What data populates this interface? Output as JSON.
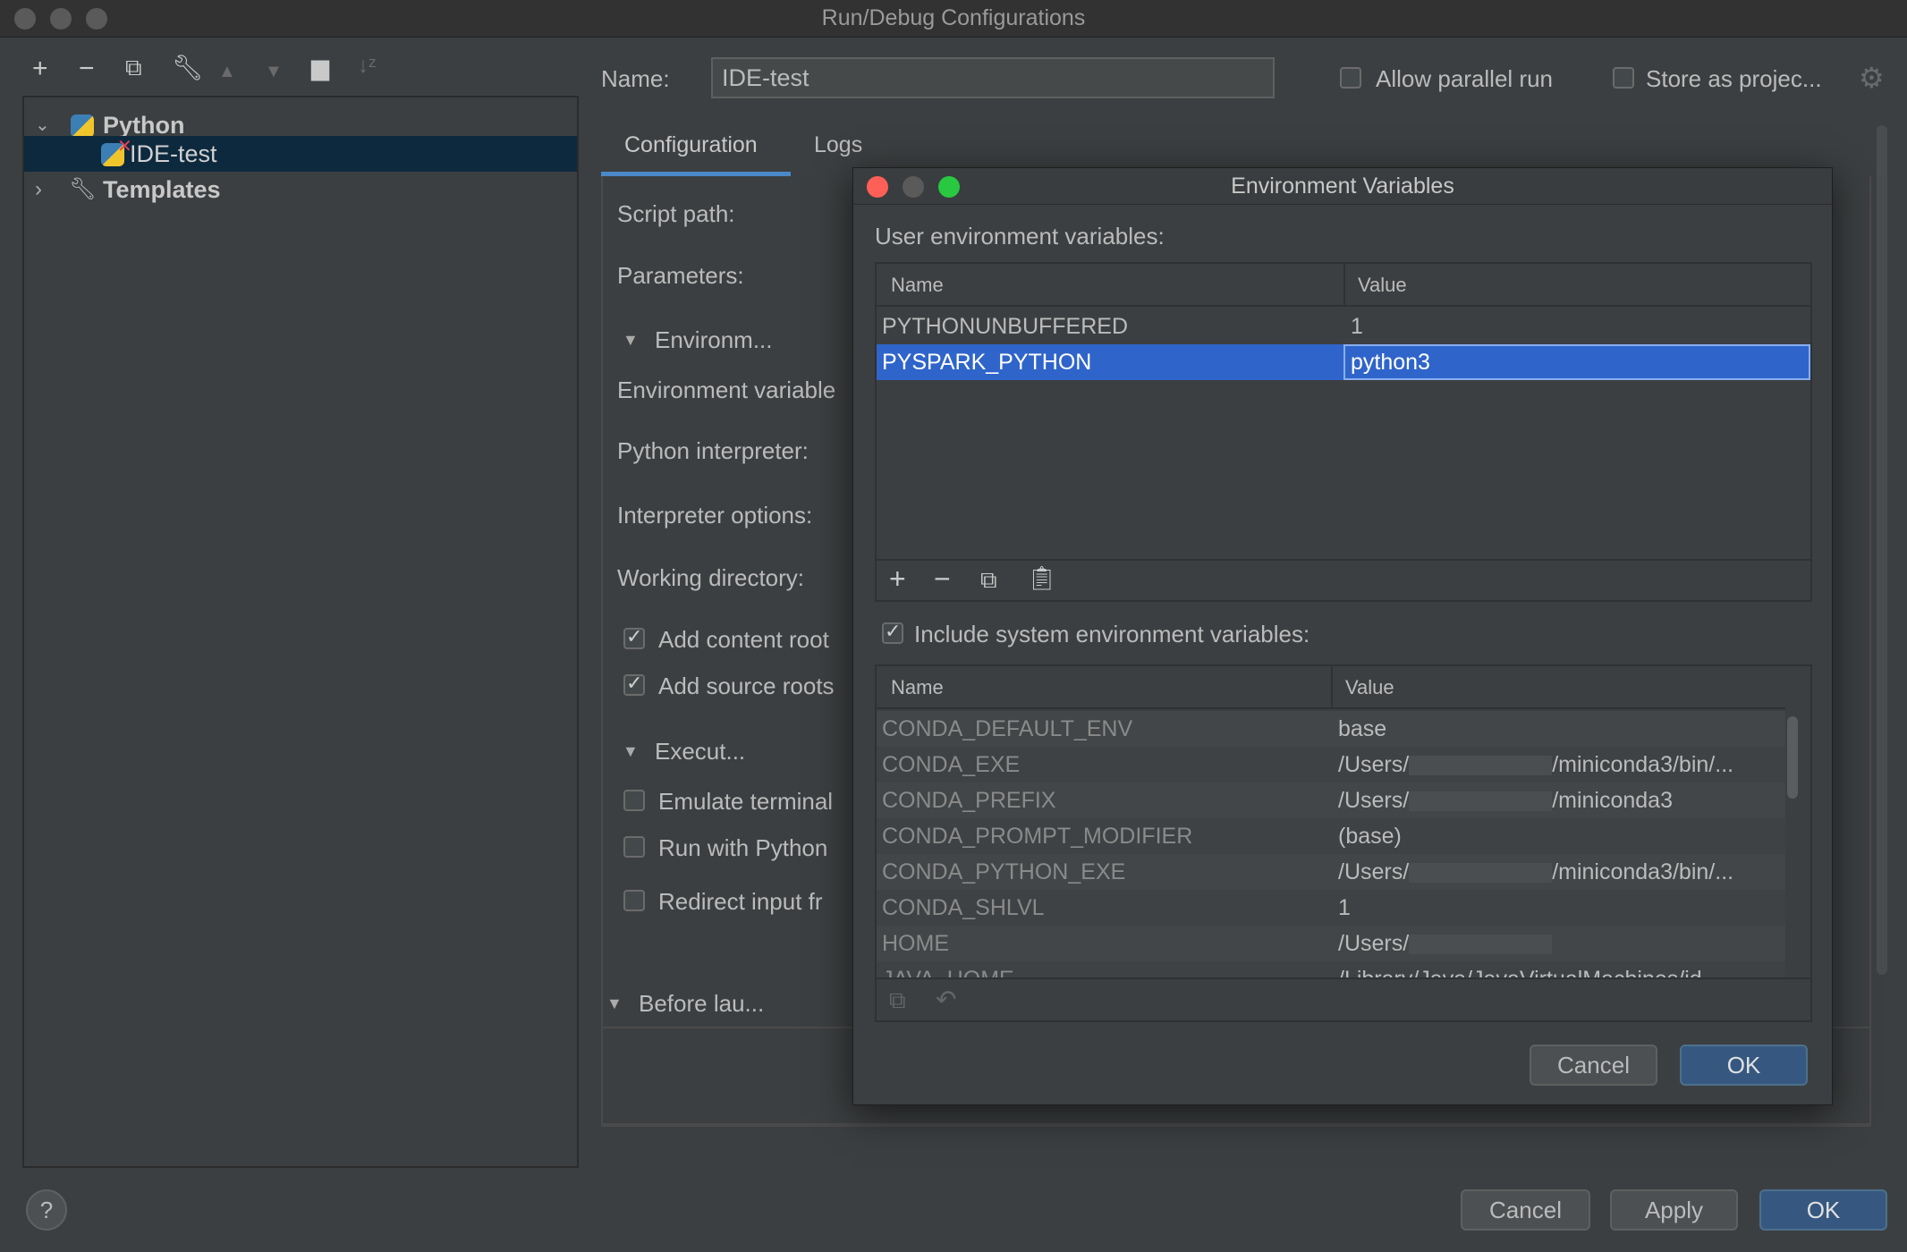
{
  "window": {
    "title": "Run/Debug Configurations"
  },
  "toolbar": {
    "icons": [
      "plus-icon",
      "minus-icon",
      "copy-icon",
      "wrench-icon",
      "arrow-up-icon",
      "arrow-down-icon",
      "new-folder-icon",
      "sort-icon"
    ]
  },
  "tree": {
    "items": [
      {
        "label": "Python",
        "expanded": true
      },
      {
        "label": "IDE-test",
        "selected": true
      },
      {
        "label": "Templates",
        "expanded": false
      }
    ]
  },
  "header": {
    "name_label": "Name:",
    "name_value": "IDE-test",
    "allow_parallel": "Allow parallel run",
    "store_project": "Store as projec..."
  },
  "tabs": [
    {
      "label": "Configuration",
      "active": true
    },
    {
      "label": "Logs"
    }
  ],
  "form": {
    "script_path": "Script path:",
    "parameters": "Parameters:",
    "env_section": "Environm...",
    "env_vars": "Environment variable",
    "interpreter": "Python interpreter:",
    "interp_options": "Interpreter options:",
    "working_dir": "Working directory:",
    "add_content": "Add content root",
    "add_source": "Add source roots",
    "exec_section": "Execut...",
    "emulate": "Emulate terminal",
    "run_with": "Run with Python",
    "redirect": "Redirect input fr",
    "before_launch": "Before lau..."
  },
  "footer": {
    "help": "?",
    "cancel": "Cancel",
    "apply": "Apply",
    "ok": "OK"
  },
  "dialog": {
    "title": "Environment Variables",
    "user_label": "User environment variables:",
    "col_name": "Name",
    "col_value": "Value",
    "user_vars": [
      {
        "name": "PYTHONUNBUFFERED",
        "value": "1"
      },
      {
        "name": "PYSPARK_PYTHON",
        "value": "python3",
        "selected": true
      }
    ],
    "include_system": "Include system environment variables:",
    "system_vars": [
      {
        "name": "CONDA_DEFAULT_ENV",
        "value": "base",
        "suffix": ""
      },
      {
        "name": "CONDA_EXE",
        "value": "/Users/",
        "suffix": "/miniconda3/bin/..."
      },
      {
        "name": "CONDA_PREFIX",
        "value": "/Users/",
        "suffix": "/miniconda3"
      },
      {
        "name": "CONDA_PROMPT_MODIFIER",
        "value": "(base)",
        "suffix": ""
      },
      {
        "name": "CONDA_PYTHON_EXE",
        "value": "/Users/",
        "suffix": "/miniconda3/bin/..."
      },
      {
        "name": "CONDA_SHLVL",
        "value": "1",
        "suffix": ""
      },
      {
        "name": "HOME",
        "value": "/Users/",
        "suffix": ""
      },
      {
        "name": "JAVA_HOME",
        "value": "/Library/Java/JavaVirtualMachines/jd",
        "suffix": ""
      }
    ],
    "cancel": "Cancel",
    "ok": "OK"
  },
  "colors": {
    "selection": "#2f65ca",
    "tree_selection": "#0d293e",
    "primary_button": "#365880",
    "tab_underline": "#4a88c7"
  }
}
